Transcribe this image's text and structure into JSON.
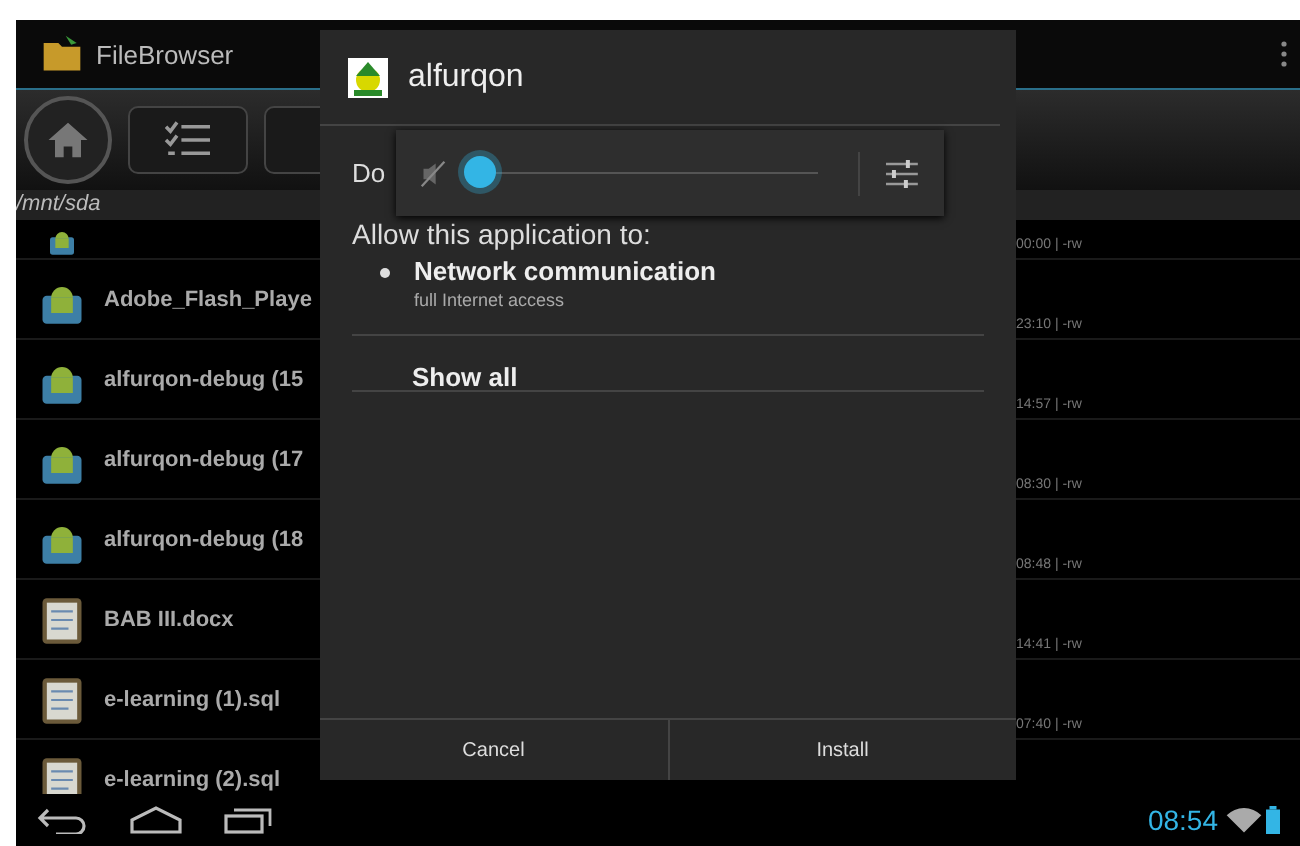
{
  "app_bar": {
    "title": "FileBrowser"
  },
  "path": "/mnt/sda",
  "files": [
    {
      "kind": "apk",
      "meta": "00:00 | -rw"
    },
    {
      "kind": "apk",
      "name": "Adobe_Flash_Playe",
      "meta": "23:10 | -rw"
    },
    {
      "kind": "apk",
      "name": "alfurqon-debug (15",
      "meta": "14:57 | -rw"
    },
    {
      "kind": "apk",
      "name": "alfurqon-debug (17",
      "meta": "08:30 | -rw"
    },
    {
      "kind": "apk",
      "name": "alfurqon-debug (18",
      "meta": "08:48 | -rw"
    },
    {
      "kind": "doc",
      "name": "BAB III.docx",
      "meta": "14:41 | -rw"
    },
    {
      "kind": "doc",
      "name": "e-learning (1).sql",
      "meta": "07:40 | -rw"
    },
    {
      "kind": "doc",
      "name": "e-learning (2).sql"
    }
  ],
  "dialog": {
    "title": "alfurqon",
    "prompt": "Do",
    "permissions_heading": "Allow this application to:",
    "permissions": [
      {
        "name": "Network communication",
        "detail": "full Internet access"
      }
    ],
    "show_all": "Show all",
    "buttons": [
      "Cancel",
      "Install"
    ]
  },
  "volume": {
    "muted": true,
    "level": 0
  },
  "status_bar": {
    "time": "08:54"
  }
}
